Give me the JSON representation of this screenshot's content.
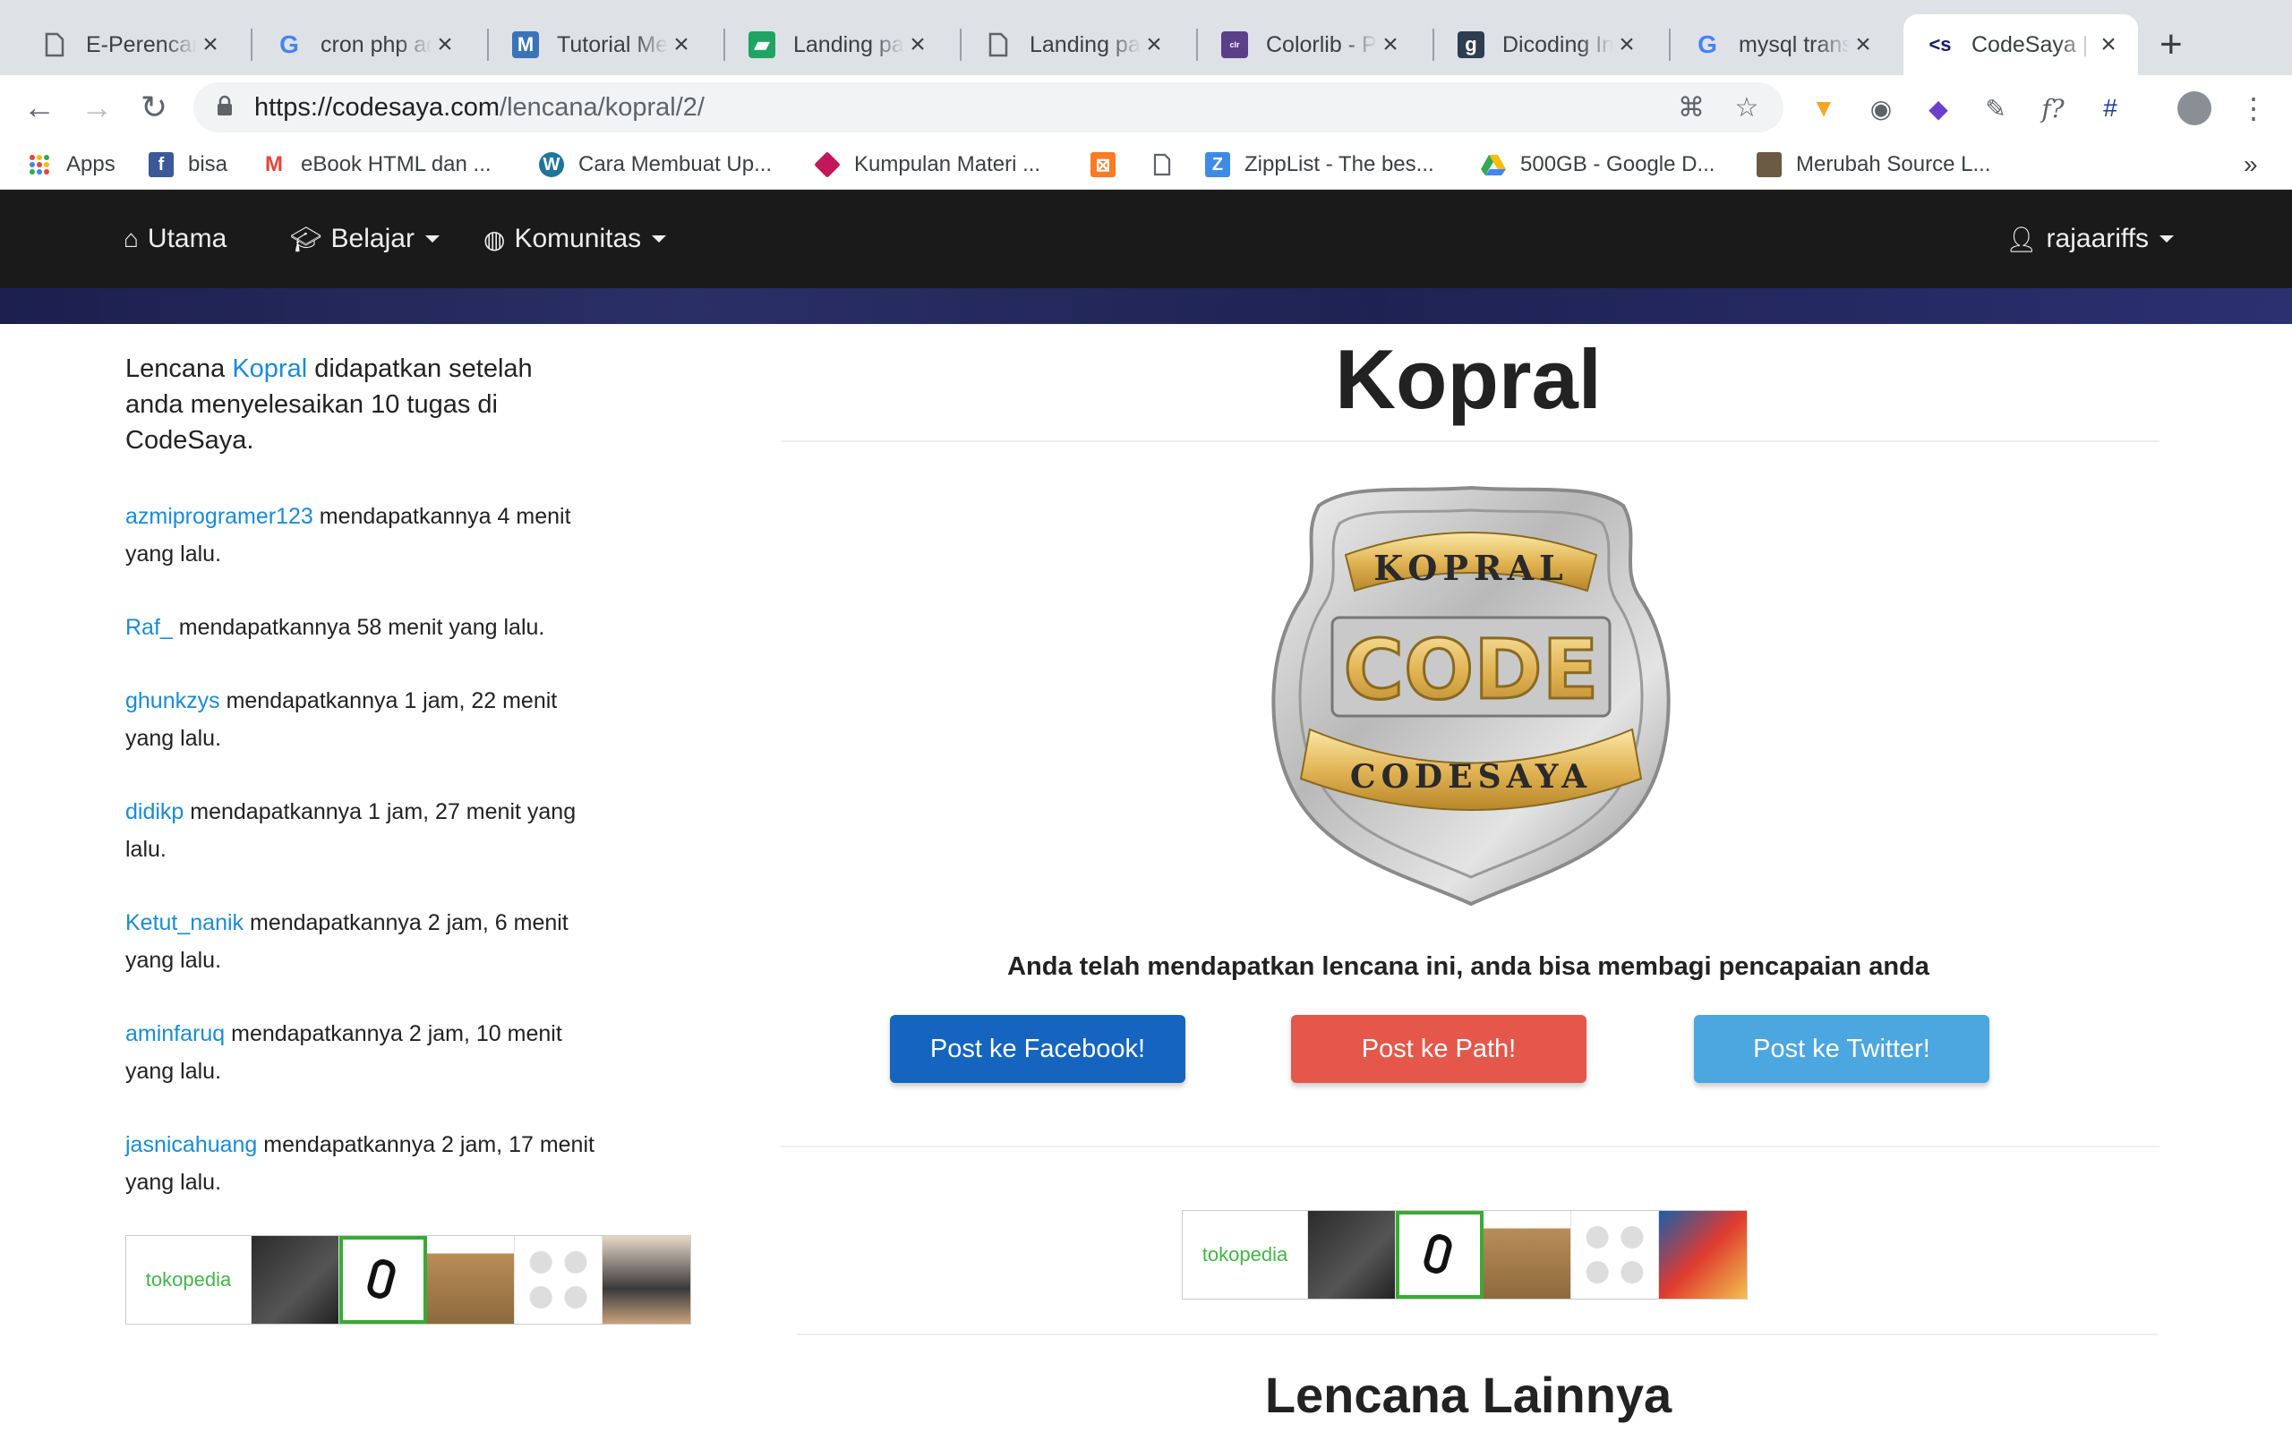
{
  "browser": {
    "tabs": [
      {
        "title": "E-Perencanaan"
      },
      {
        "title": "cron php adalah"
      },
      {
        "title": "Tutorial Membuat"
      },
      {
        "title": "Landing page"
      },
      {
        "title": "Landing page"
      },
      {
        "title": "Colorlib - Premium"
      },
      {
        "title": "Dicoding Indonesia"
      },
      {
        "title": "mysql transaction"
      },
      {
        "title": "CodeSaya | Kopral"
      }
    ],
    "url_host": "https://codesaya.com",
    "url_path": "/lencana/kopral/2/",
    "bookmarks": [
      "Apps",
      "bisa",
      "eBook HTML dan ...",
      "Cara Membuat Up...",
      "Kumpulan Materi ...",
      "",
      "",
      "ZippList - The bes...",
      "500GB - Google D...",
      "Merubah Source L..."
    ],
    "bookmarks_more": "»"
  },
  "nav": {
    "home": "Utama",
    "learn": "Belajar",
    "community": "Komunitas",
    "user": "rajaariffs"
  },
  "sidebar": {
    "intro_before": "Lencana ",
    "intro_link": "Kopral",
    "intro_after": " didapatkan setelah anda menyelesaikan 10 tugas di CodeSaya.",
    "entries": [
      {
        "user": "azmiprogramer123",
        "text": " mendapatkannya 4 menit yang lalu."
      },
      {
        "user": "Raf_",
        "text": " mendapatkannya 58 menit yang lalu."
      },
      {
        "user": "ghunkzys",
        "text": " mendapatkannya 1 jam, 22 menit yang lalu."
      },
      {
        "user": "didikp",
        "text": " mendapatkannya 1 jam, 27 menit yang lalu."
      },
      {
        "user": "Ketut_nanik",
        "text": " mendapatkannya 2 jam, 6 menit yang lalu."
      },
      {
        "user": "aminfaruq",
        "text": " mendapatkannya 2 jam, 10 menit yang lalu."
      },
      {
        "user": "jasnicahuang",
        "text": " mendapatkannya 2 jam, 17 menit yang lalu."
      }
    ]
  },
  "ads": {
    "brand": "tokopedia"
  },
  "main": {
    "title": "Kopral",
    "badge_top": "KOPRAL",
    "badge_mid": "CODE",
    "badge_bottom": "CODESAYA",
    "achieved": "Anda telah mendapatkan lencana ini, anda bisa membagi pencapaian anda",
    "share_facebook": "Post ke Facebook!",
    "share_path": "Post ke Path!",
    "share_twitter": "Post ke Twitter!",
    "other_badges": "Lencana Lainnya"
  },
  "colors": {
    "facebook": "#1565c0",
    "path": "#e5574b",
    "twitter": "#4ca6e0",
    "link": "#1a8bd8",
    "navbar": "#1a1a1a"
  }
}
